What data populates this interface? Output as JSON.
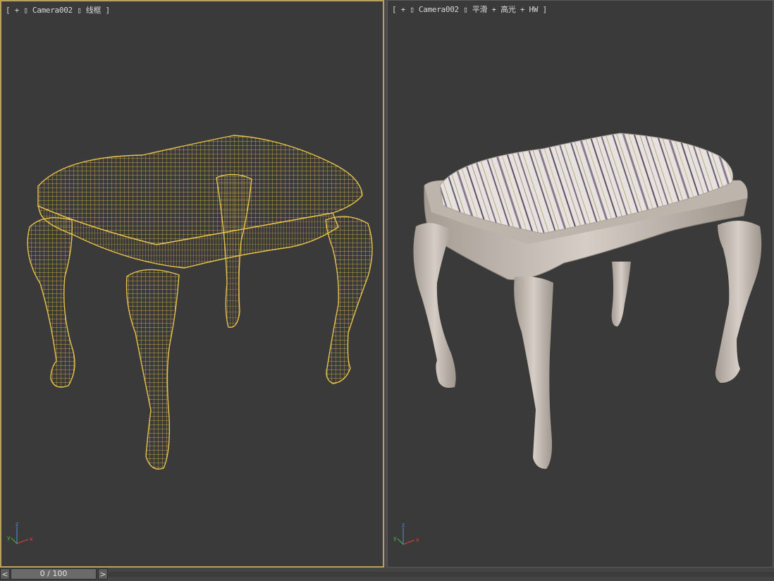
{
  "viewports": {
    "left": {
      "label": "[ + ▯ Camera002 ▯ 线框 ]",
      "mode": "wireframe",
      "active": true
    },
    "right": {
      "label": "[ + ▯ Camera002 ▯ 平滑 + 高光 + HW ]",
      "mode": "smooth-highlights",
      "active": false
    }
  },
  "axis_gizmo": {
    "x": "x",
    "y": "y",
    "z": "z"
  },
  "timeline": {
    "frame_display": "0 / 100",
    "prev": "<",
    "next": ">"
  },
  "colors": {
    "viewport_bg": "#3a3a3a",
    "active_border": "#b8a15c",
    "wireframe": "#e8c24a",
    "shaded_body": "#c9c0b8"
  },
  "icons": {
    "axis": "xyz-axis-icon",
    "prev": "chevron-left-icon",
    "next": "chevron-right-icon"
  }
}
